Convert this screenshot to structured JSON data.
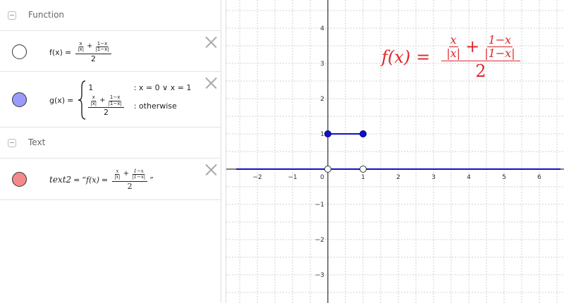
{
  "algebra": {
    "groups": [
      {
        "label": "Function"
      },
      {
        "label": "Text"
      }
    ],
    "f": {
      "lhs": "f(x)",
      "eq": "=",
      "term1_num": "x",
      "term1_den": "|x|",
      "plus": "+",
      "term2_num": "1−x",
      "term2_den": "|1−x|",
      "denominator": "2",
      "marble_color": "#ffffff"
    },
    "g": {
      "lhs": "g(x)",
      "eq": "=",
      "case1_value": "1",
      "case1_cond": ": x = 0 ∨ x = 1",
      "case2_term1_num": "x",
      "case2_term1_den": "|x|",
      "plus": "+",
      "case2_term2_num": "1−x",
      "case2_term2_den": "|1−x|",
      "case2_denominator": "2",
      "case2_cond": ": otherwise",
      "marble_color": "#9a9aff"
    },
    "text2": {
      "lhs": "text2",
      "eq": "=",
      "open_quote": "“",
      "f_label": "f(x)",
      "inner_eq": "=",
      "term1_num": "x",
      "term1_den": "|x|",
      "plus": "+",
      "term2_num": "1−x",
      "term2_den": "|1−x|",
      "denominator": "2",
      "close_quote": "”",
      "marble_color": "#f48a8a"
    }
  },
  "graph": {
    "x_ticks": [
      "−2",
      "−1",
      "0",
      "1",
      "2",
      "3",
      "4",
      "5",
      "6"
    ],
    "y_ticks": [
      "4",
      "3",
      "2",
      "1",
      "−1",
      "−2",
      "−3"
    ],
    "big_formula": {
      "lhs": "f(x)",
      "eq": "=",
      "term1_num": "x",
      "term1_den": "|x|",
      "plus": "+",
      "term2_num": "1−x",
      "term2_den": "|1−x|",
      "denominator": "2"
    },
    "colors": {
      "function": "#1010c8",
      "text": "#e0262b",
      "grid": "#d0d0d0",
      "axis": "#000000"
    }
  },
  "chart_data": {
    "type": "line",
    "xlim": [
      -2.6,
      6.6
    ],
    "ylim": [
      -3.7,
      4.8
    ],
    "grid": true,
    "series": [
      {
        "points": [
          [
            -2.6,
            0
          ],
          [
            6.6,
            0
          ]
        ]
      },
      {
        "points": [
          [
            0,
            1
          ],
          [
            1,
            1
          ]
        ]
      }
    ],
    "filled_points": [
      [
        0,
        1
      ],
      [
        1,
        1
      ]
    ],
    "open_points": [
      [
        0,
        0
      ],
      [
        1,
        0
      ]
    ]
  }
}
